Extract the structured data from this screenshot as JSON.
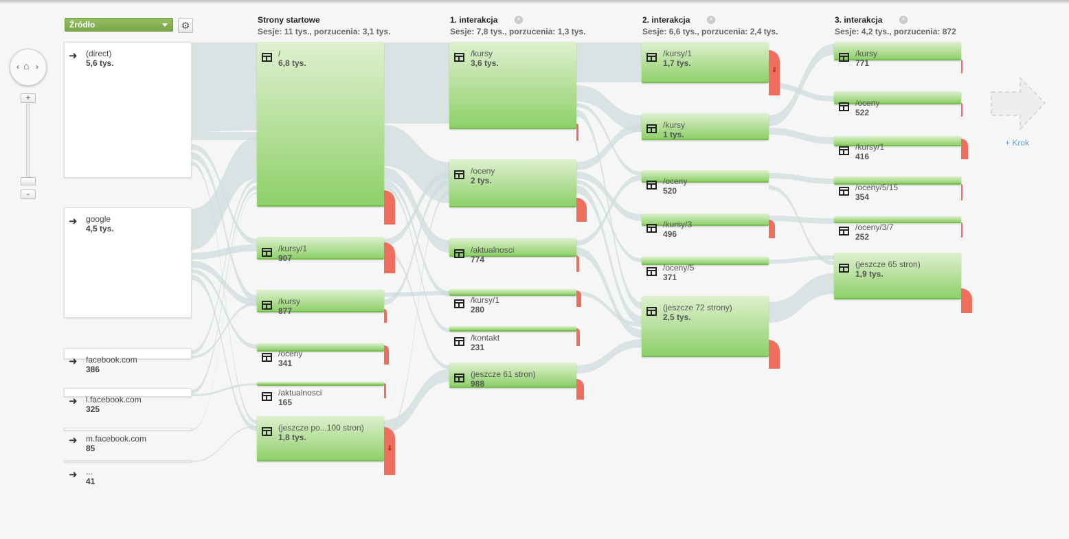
{
  "toolbar": {
    "dimension_label": "Źródło",
    "settings_icon": "gear-icon",
    "add_step_label": "+ Krok"
  },
  "navigation": {
    "home_icon": "home-icon",
    "left_icon": "chevron-left-icon",
    "right_icon": "chevron-right-icon",
    "zoom_in_label": "+",
    "zoom_out_label": "-"
  },
  "columns": [
    {
      "title": "Strony startowe",
      "sub": "Sesje: 11 tys., porzucenia: 3,1 tys."
    },
    {
      "title": "1. interakcja",
      "sub": "Sesje: 7,8 tys., porzucenia: 1,3 tys."
    },
    {
      "title": "2. interakcja",
      "sub": "Sesje: 6,6 tys., porzucenia: 2,4 tys."
    },
    {
      "title": "3. interakcja",
      "sub": "Sesje: 4,2 tys., porzucenia: 872"
    }
  ],
  "sources": [
    {
      "label": "(direct)",
      "value": "5,6 tys."
    },
    {
      "label": "google",
      "value": "4,5 tys."
    },
    {
      "label": "facebook.com",
      "value": "386"
    },
    {
      "label": "l.facebook.com",
      "value": "325"
    },
    {
      "label": "m.facebook.com",
      "value": "85"
    },
    {
      "label": "...",
      "value": "41"
    }
  ],
  "steps": [
    [
      {
        "label": "/",
        "value": "6,8 tys."
      },
      {
        "label": "/kursy/1",
        "value": "907"
      },
      {
        "label": "/kursy",
        "value": "877"
      },
      {
        "label": "/oceny",
        "value": "341"
      },
      {
        "label": "/aktualnosci",
        "value": "165"
      },
      {
        "label": "(jeszcze po...100 stron)",
        "value": "1,8 tys."
      }
    ],
    [
      {
        "label": "/kursy",
        "value": "3,6 tys."
      },
      {
        "label": "/oceny",
        "value": "2 tys."
      },
      {
        "label": "/aktualnosci",
        "value": "774"
      },
      {
        "label": "/kursy/1",
        "value": "280"
      },
      {
        "label": "/kontakt",
        "value": "231"
      },
      {
        "label": "(jeszcze 61 stron)",
        "value": "988"
      }
    ],
    [
      {
        "label": "/kursy/1",
        "value": "1,7 tys."
      },
      {
        "label": "/kursy",
        "value": "1 tys."
      },
      {
        "label": "/oceny",
        "value": "520"
      },
      {
        "label": "/kursy/3",
        "value": "496"
      },
      {
        "label": "/oceny/5",
        "value": "371"
      },
      {
        "label": "(jeszcze 72 strony)",
        "value": "2,5 tys."
      }
    ],
    [
      {
        "label": "/kursy",
        "value": "771"
      },
      {
        "label": "/oceny",
        "value": "522"
      },
      {
        "label": "/kursy/1",
        "value": "416"
      },
      {
        "label": "/oceny/5/15",
        "value": "354"
      },
      {
        "label": "/oceny/3/7",
        "value": "252"
      },
      {
        "label": "(jeszcze 65 stron)",
        "value": "1,9 tys."
      }
    ]
  ]
}
